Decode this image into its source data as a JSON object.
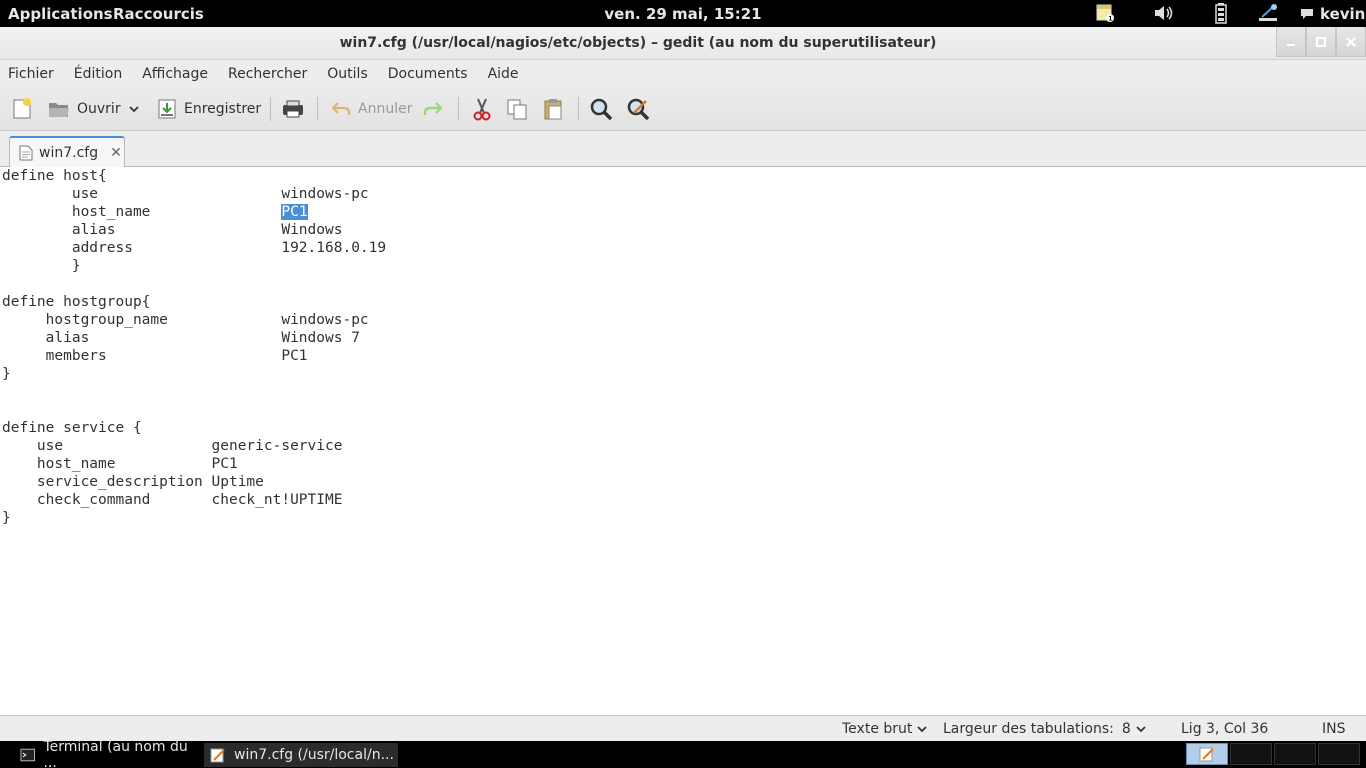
{
  "top_panel": {
    "applications": "Applications",
    "shortcuts": "Raccourcis",
    "clock": "ven. 29 mai, 15:21",
    "user": "kevin",
    "tray_icons": [
      "notes-icon",
      "volume-icon",
      "battery-icon",
      "network-icon"
    ]
  },
  "window": {
    "title": "win7.cfg (/usr/local/nagios/etc/objects) – gedit (au nom du superutilisateur)"
  },
  "menubar": {
    "items": [
      "Fichier",
      "Édition",
      "Affichage",
      "Rechercher",
      "Outils",
      "Documents",
      "Aide"
    ]
  },
  "toolbar": {
    "open_label": "Ouvrir",
    "save_label": "Enregistrer",
    "undo_label": "Annuler"
  },
  "tab": {
    "label": "win7.cfg"
  },
  "editor": {
    "lines": [
      "define host{",
      "        use                     windows-pc",
      "        host_name               ",
      "        alias                   Windows",
      "        address                 192.168.0.19",
      "        }",
      "",
      "define hostgroup{",
      "     hostgroup_name             windows-pc",
      "     alias                      Windows 7",
      "     members                    PC1",
      "}",
      "",
      "",
      "define service {",
      "    use                 generic-service",
      "    host_name           PC1",
      "    service_description Uptime",
      "    check_command       check_nt!UPTIME",
      "}"
    ],
    "selected_text": "PC1"
  },
  "statusbar": {
    "language": "Texte brut",
    "tab_width_label": "Largeur des tabulations:",
    "tab_width": "8",
    "position": "Lig 3, Col 36",
    "mode": "INS"
  },
  "taskbar": {
    "tasks": [
      "Terminal (au nom du ...",
      "win7.cfg (/usr/local/n..."
    ]
  },
  "colors": {
    "selection": "#4a90d9",
    "panel": "#000000"
  }
}
